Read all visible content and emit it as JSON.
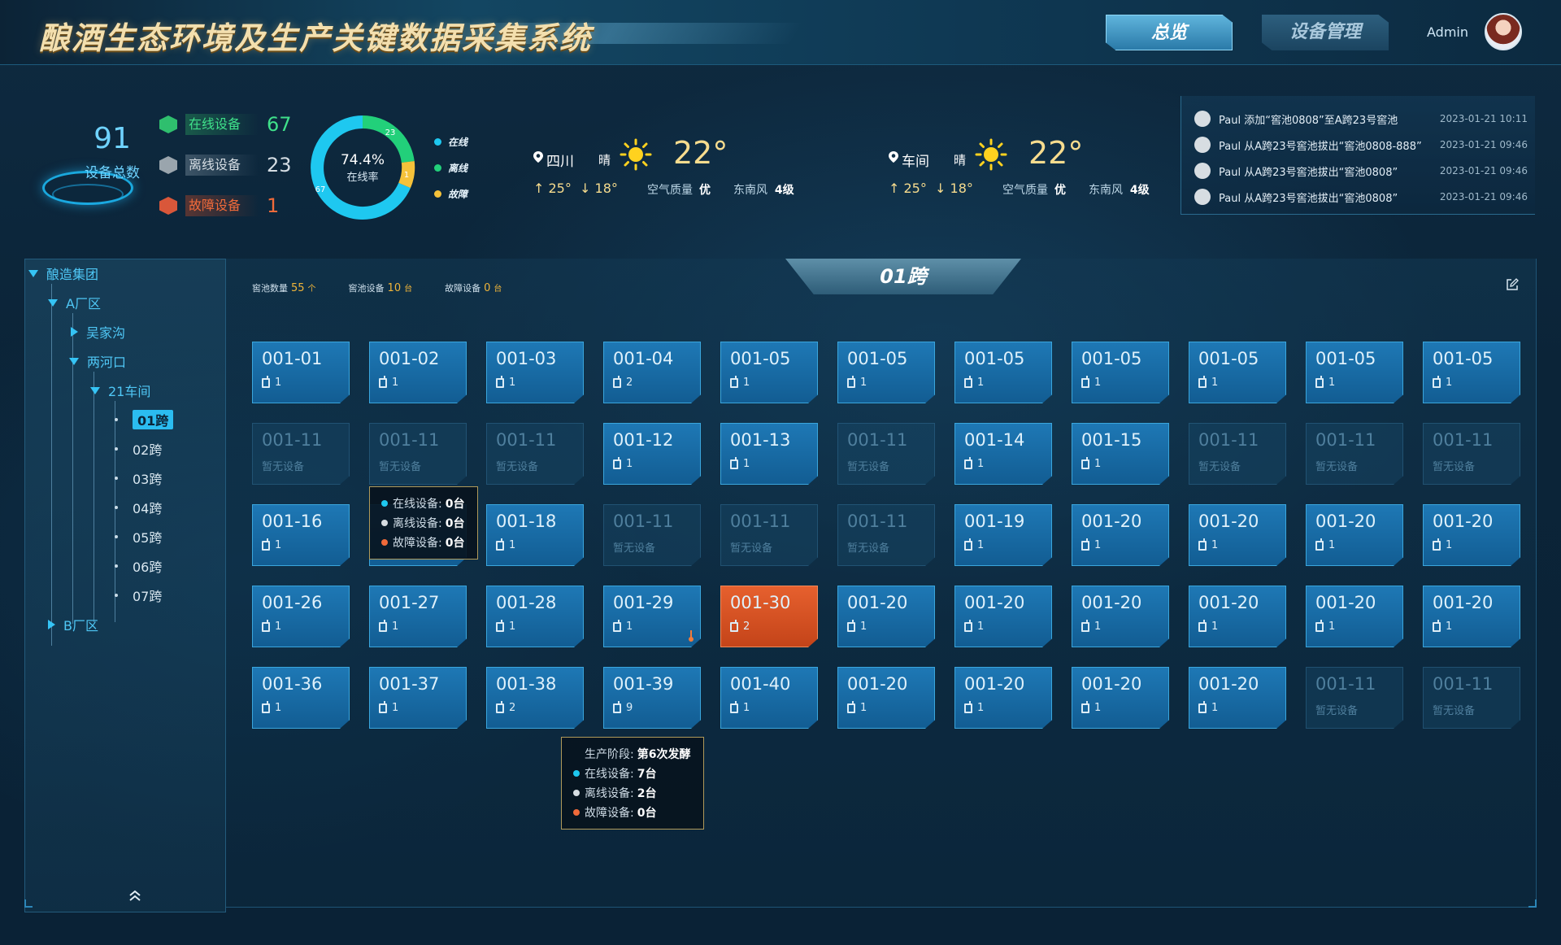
{
  "app": {
    "title": "酿酒生态环境及生产关键数据采集系统",
    "nav": {
      "overview": "总览",
      "device_mgmt": "设备管理"
    },
    "user": "Admin"
  },
  "stats": {
    "total": {
      "value": "91",
      "label": "设备总数"
    },
    "online": {
      "label": "在线设备",
      "value": "67",
      "color": "#3fe08a"
    },
    "offline": {
      "label": "离线设备",
      "value": "23",
      "color": "#cfd6dc"
    },
    "fault": {
      "label": "故障设备",
      "value": "1",
      "color": "#f06a3a"
    },
    "donut": {
      "percent": "74.4%",
      "label": "在线率",
      "seg_online": "67",
      "seg_offline": "23",
      "seg_fault": "1",
      "legend_online": "在线",
      "legend_offline": "离线",
      "legend_fault": "故障",
      "color_online": "#1ec8f0",
      "color_offline": "#22d07a",
      "color_fault": "#f5c23a"
    }
  },
  "weather": [
    {
      "location": "四川",
      "condition": "晴",
      "temp": "22°",
      "high": "↑ 25°",
      "low": "↓ 18°",
      "aq_label": "空气质量",
      "aq": "优",
      "wind_dir": "东南风",
      "wind_level": "4级"
    },
    {
      "location": "车间",
      "condition": "晴",
      "temp": "22°",
      "high": "↑ 25°",
      "low": "↓ 18°",
      "aq_label": "空气质量",
      "aq": "优",
      "wind_dir": "东南风",
      "wind_level": "4级"
    }
  ],
  "logs": [
    {
      "text": "Paul 添加“窖池0808”至A跨23号窖池",
      "time": "2023-01-21 10:11"
    },
    {
      "text": "Paul 从A跨23号窖池拔出“窖池0808-888”",
      "time": "2023-01-21 09:46"
    },
    {
      "text": "Paul 从A跨23号窖池拔出“窖池0808”",
      "time": "2023-01-21 09:46"
    },
    {
      "text": "Paul 从A跨23号窖池拔出“窖池0808”",
      "time": "2023-01-21 09:46"
    }
  ],
  "tree": {
    "root": "酿造集团",
    "a_zone": "A厂区",
    "wujiagou": "吴家沟",
    "lianghekou": "两河口",
    "workshop": "21车间",
    "spans": [
      "01跨",
      "02跨",
      "03跨",
      "04跨",
      "05跨",
      "06跨",
      "07跨"
    ],
    "b_zone": "B厂区"
  },
  "main": {
    "title": "01跨",
    "pit_count_label": "窖池数量",
    "pit_count": "55",
    "pit_count_unit": "个",
    "pit_device_label": "窖池设备",
    "pit_device": "10",
    "pit_device_unit": "台",
    "fault_device_label": "故障设备",
    "fault_device": "0",
    "fault_device_unit": "台"
  },
  "cells": [
    {
      "id": "001-01",
      "sub": "1"
    },
    {
      "id": "001-02",
      "sub": "1"
    },
    {
      "id": "001-03",
      "sub": "1"
    },
    {
      "id": "001-04",
      "sub": "2"
    },
    {
      "id": "001-05",
      "sub": "1"
    },
    {
      "id": "001-05",
      "sub": "1"
    },
    {
      "id": "001-05",
      "sub": "1"
    },
    {
      "id": "001-05",
      "sub": "1"
    },
    {
      "id": "001-05",
      "sub": "1"
    },
    {
      "id": "001-05",
      "sub": "1"
    },
    {
      "id": "001-05",
      "sub": "1"
    },
    {
      "id": "001-11",
      "sub": "暂无设备",
      "state": "empty"
    },
    {
      "id": "001-11",
      "sub": "暂无设备",
      "state": "empty"
    },
    {
      "id": "001-11",
      "sub": "暂无设备",
      "state": "empty"
    },
    {
      "id": "001-12",
      "sub": "1"
    },
    {
      "id": "001-13",
      "sub": "1"
    },
    {
      "id": "001-11",
      "sub": "暂无设备",
      "state": "empty"
    },
    {
      "id": "001-14",
      "sub": "1"
    },
    {
      "id": "001-15",
      "sub": "1"
    },
    {
      "id": "001-11",
      "sub": "暂无设备",
      "state": "empty"
    },
    {
      "id": "001-11",
      "sub": "暂无设备",
      "state": "empty"
    },
    {
      "id": "001-11",
      "sub": "暂无设备",
      "state": "empty"
    },
    {
      "id": "001-16",
      "sub": "1"
    },
    {
      "id": "",
      "sub": ""
    },
    {
      "id": "001-18",
      "sub": "1"
    },
    {
      "id": "001-11",
      "sub": "暂无设备",
      "state": "empty"
    },
    {
      "id": "001-11",
      "sub": "暂无设备",
      "state": "empty"
    },
    {
      "id": "001-11",
      "sub": "暂无设备",
      "state": "empty"
    },
    {
      "id": "001-19",
      "sub": "1"
    },
    {
      "id": "001-20",
      "sub": "1"
    },
    {
      "id": "001-20",
      "sub": "1"
    },
    {
      "id": "001-20",
      "sub": "1"
    },
    {
      "id": "001-20",
      "sub": "1"
    },
    {
      "id": "001-26",
      "sub": "1"
    },
    {
      "id": "001-27",
      "sub": "1"
    },
    {
      "id": "001-28",
      "sub": "1"
    },
    {
      "id": "001-29",
      "sub": "1",
      "thermo": true
    },
    {
      "id": "001-30",
      "sub": "2",
      "state": "alarm"
    },
    {
      "id": "001-20",
      "sub": "1"
    },
    {
      "id": "001-20",
      "sub": "1"
    },
    {
      "id": "001-20",
      "sub": "1"
    },
    {
      "id": "001-20",
      "sub": "1"
    },
    {
      "id": "001-20",
      "sub": "1"
    },
    {
      "id": "001-20",
      "sub": "1"
    },
    {
      "id": "001-36",
      "sub": "1"
    },
    {
      "id": "001-37",
      "sub": "1"
    },
    {
      "id": "001-38",
      "sub": "2"
    },
    {
      "id": "001-39",
      "sub": "9"
    },
    {
      "id": "001-40",
      "sub": "1"
    },
    {
      "id": "001-20",
      "sub": "1"
    },
    {
      "id": "001-20",
      "sub": "1"
    },
    {
      "id": "001-20",
      "sub": "1"
    },
    {
      "id": "001-20",
      "sub": "1"
    },
    {
      "id": "001-11",
      "sub": "暂无设备",
      "state": "empty"
    },
    {
      "id": "001-11",
      "sub": "暂无设备",
      "state": "empty"
    }
  ],
  "tooltip1": {
    "online_label": "在线设备:",
    "online": "0台",
    "offline_label": "离线设备:",
    "offline": "0台",
    "fault_label": "故障设备:",
    "fault": "0台"
  },
  "tooltip2": {
    "stage_label": "生产阶段:",
    "stage": "第6次发酵",
    "online_label": "在线设备:",
    "online": "7台",
    "offline_label": "离线设备:",
    "offline": "2台",
    "fault_label": "故障设备:",
    "fault": "0台"
  },
  "icons": {
    "location": "map-pin-icon",
    "sun": "sun-icon",
    "device": "device-icon",
    "edit": "edit-icon",
    "collapse": "double-chevron-up-icon",
    "thermometer": "thermometer-icon"
  }
}
